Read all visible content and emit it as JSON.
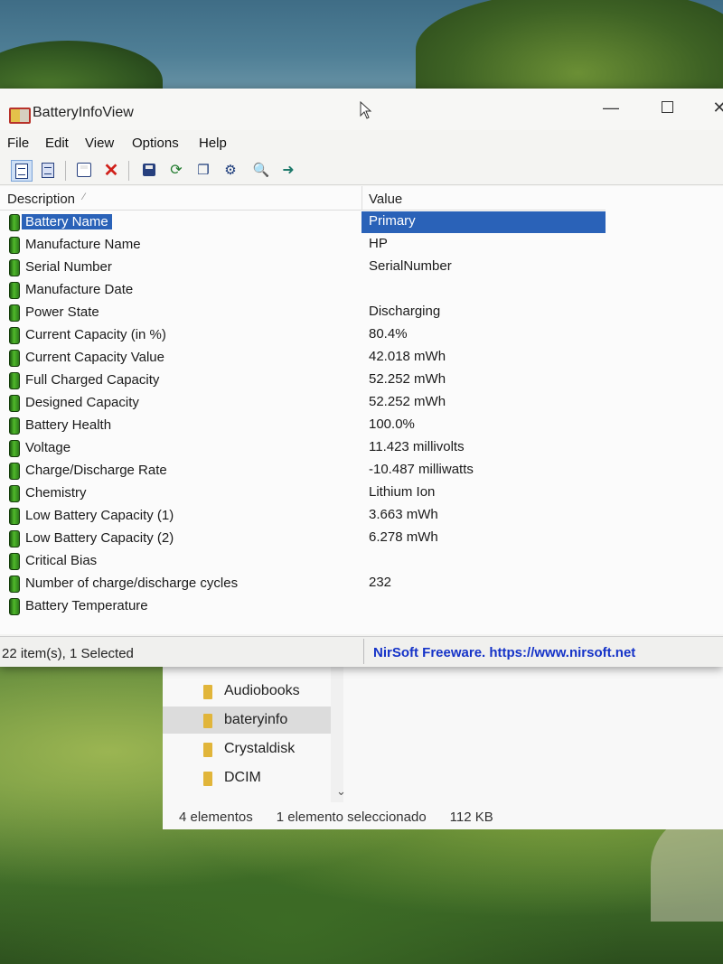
{
  "window": {
    "title": "BatteryInfoView"
  },
  "menu": [
    "File",
    "Edit",
    "View",
    "Options",
    "Help"
  ],
  "columns": {
    "description": "Description",
    "value": "Value"
  },
  "rows": [
    {
      "name": "Battery Name",
      "value": "Primary"
    },
    {
      "name": "Manufacture Name",
      "value": "HP"
    },
    {
      "name": "Serial Number",
      "value": "SerialNumber"
    },
    {
      "name": "Manufacture Date",
      "value": ""
    },
    {
      "name": "Power State",
      "value": "Discharging"
    },
    {
      "name": "Current Capacity (in %)",
      "value": "80.4%"
    },
    {
      "name": "Current Capacity Value",
      "value": "42.018 mWh"
    },
    {
      "name": "Full Charged Capacity",
      "value": "52.252 mWh"
    },
    {
      "name": "Designed Capacity",
      "value": "52.252 mWh"
    },
    {
      "name": "Battery Health",
      "value": "100.0%"
    },
    {
      "name": "Voltage",
      "value": "11.423 millivolts"
    },
    {
      "name": "Charge/Discharge Rate",
      "value": "-10.487 milliwatts"
    },
    {
      "name": "Chemistry",
      "value": "Lithium Ion"
    },
    {
      "name": "Low Battery Capacity (1)",
      "value": "3.663 mWh"
    },
    {
      "name": "Low Battery Capacity (2)",
      "value": "6.278 mWh"
    },
    {
      "name": "Critical Bias",
      "value": ""
    },
    {
      "name": "Number of charge/discharge cycles",
      "value": "232"
    },
    {
      "name": "Battery Temperature",
      "value": ""
    }
  ],
  "status": {
    "items": "22 item(s), 1 Selected",
    "link": "NirSoft Freeware. https://www.nirsoft.net"
  },
  "explorer": {
    "folders": [
      "Audiobooks",
      "bateryinfo",
      "Crystaldisk",
      "DCIM"
    ],
    "status": {
      "count": "4 elementos",
      "selected": "1 elemento seleccionado",
      "size": "112 KB"
    }
  },
  "colors": {
    "selection": "#2a62b8",
    "link": "#1533c8",
    "battery_icon": "#3f9a22",
    "folder_icon": "#e1b53a"
  },
  "icons": {
    "toolbar": [
      "properties-icon",
      "html-report-icon",
      "table-icon",
      "delete-icon",
      "save-icon",
      "refresh-icon",
      "copy-icon",
      "options-icon",
      "find-icon",
      "exit-icon"
    ]
  }
}
